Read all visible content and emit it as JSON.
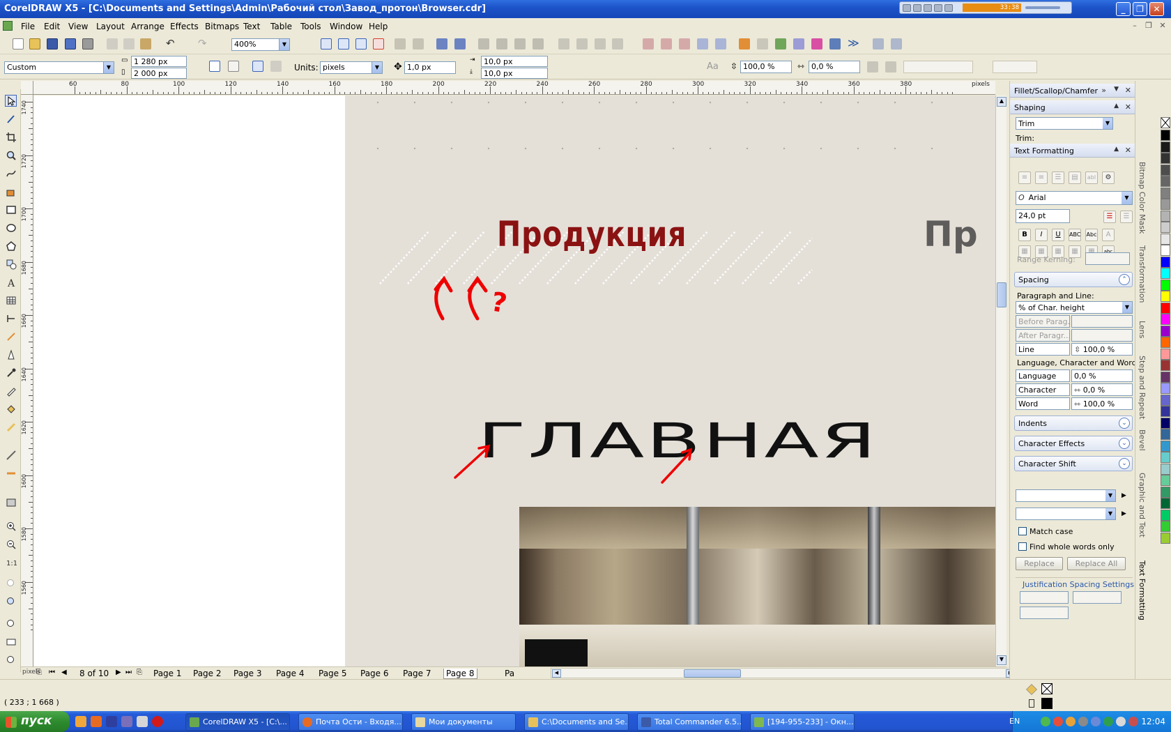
{
  "titlebar": {
    "title": "CorelDRAW X5 - [C:\\Documents and Settings\\Admin\\Рабочий стол\\Завод_протон\\Browser.cdr]",
    "player_time": "33:38"
  },
  "menu": [
    "File",
    "Edit",
    "View",
    "Layout",
    "Arrange",
    "Effects",
    "Bitmaps",
    "Text",
    "Table",
    "Tools",
    "Window",
    "Help"
  ],
  "toolbar": {
    "zoom": "400%"
  },
  "propbar": {
    "preset": "Custom",
    "width": "1 280 px",
    "height": "2 000 px",
    "units_label": "Units:",
    "units": "pixels",
    "nudge": "1,0 px",
    "dup_x": "10,0 px",
    "dup_y": "10,0 px",
    "line_spacing": "100,0 %",
    "char_spacing": "0,0 %"
  },
  "ruler_h": {
    "unit": "pixels",
    "labels": [
      "60",
      "80",
      "100",
      "120",
      "140",
      "160",
      "180",
      "200",
      "220",
      "240",
      "260",
      "280",
      "300",
      "320",
      "340",
      "360",
      "380"
    ]
  },
  "ruler_v": {
    "labels": [
      "1740",
      "1720",
      "1700",
      "1680",
      "1660",
      "1640",
      "1620",
      "1600",
      "1580",
      "1560"
    ]
  },
  "canvas": {
    "heading": "Продукция",
    "heading_partial": "Пр",
    "main_text": "ГЛАВНАЯ",
    "annotation": "?"
  },
  "pages": {
    "counter": "8 of 10",
    "tabs": [
      "Page 1",
      "Page 2",
      "Page 3",
      "Page 4",
      "Page 5",
      "Page 6",
      "Page 7",
      "Page 8",
      "Pa"
    ],
    "active_index": 7
  },
  "status": {
    "coords": "( 233  ; 1 668 )"
  },
  "docker": {
    "fillet_title": "Fillet/Scallop/Chamfer",
    "shaping_title": "Shaping",
    "shaping_mode": "Trim",
    "shaping_label": "Trim:",
    "text_title": "Text Formatting",
    "font": "Arial",
    "size": "24,0 pt",
    "range_kerning": "Range Kerning:",
    "spacing": "Spacing",
    "para_line": "Paragraph and Line:",
    "para_unit": "% of Char. height",
    "before_para": "Before Parag...",
    "after_para": "After Paragr...",
    "line_label": "Line",
    "line_value": "100,0 %",
    "lcw": "Language, Character and Word:",
    "language_label": "Language",
    "language_value": "0,0 %",
    "character_label": "Character",
    "character_value": "0,0 %",
    "word_label": "Word",
    "word_value": "100,0 %",
    "indents": "Indents",
    "char_effects": "Character Effects",
    "char_shift": "Character Shift",
    "match_case": "Match case",
    "whole_words": "Find whole words only",
    "replace": "Replace",
    "replace_all": "Replace All",
    "justification": "Justification Spacing Settings"
  },
  "docker_tabs": [
    "Bitmap Color Mask",
    "Transformation",
    "Lens",
    "Step and Repeat",
    "Bevel",
    "Graphic and Text",
    "Text Formatting"
  ],
  "palette": [
    "#000000",
    "#1a1a1a",
    "#333333",
    "#4d4d4d",
    "#666666",
    "#808080",
    "#999999",
    "#b3b3b3",
    "#cccccc",
    "#e6e6e6",
    "#ffffff",
    "#0000ff",
    "#00ffff",
    "#00ff00",
    "#ffff00",
    "#ff0000",
    "#ff00ff",
    "#9900cc",
    "#ff6600",
    "#ff9999",
    "#993333",
    "#663366",
    "#9999ff",
    "#6666cc",
    "#333399",
    "#000066",
    "#336699",
    "#3399cc",
    "#66cccc",
    "#99cccc",
    "#66cc99",
    "#339966",
    "#006633",
    "#00cc66",
    "#33cc33",
    "#99cc33"
  ],
  "taskbar": {
    "start": "пуск",
    "tasks": [
      "CorelDRAW X5 - [C:\\...",
      "Почта Ости - Входя...",
      "Мои документы",
      "C:\\Documents and Se...",
      "Total Commander 6.5...",
      "[194-955-233] - Окн..."
    ],
    "lang": "EN",
    "clock": "12:04"
  },
  "colors": {
    "accent": "#245ad8",
    "heading": "#8b1212",
    "page_bg": "#e4e0d8",
    "annotation": "#ee0000"
  }
}
